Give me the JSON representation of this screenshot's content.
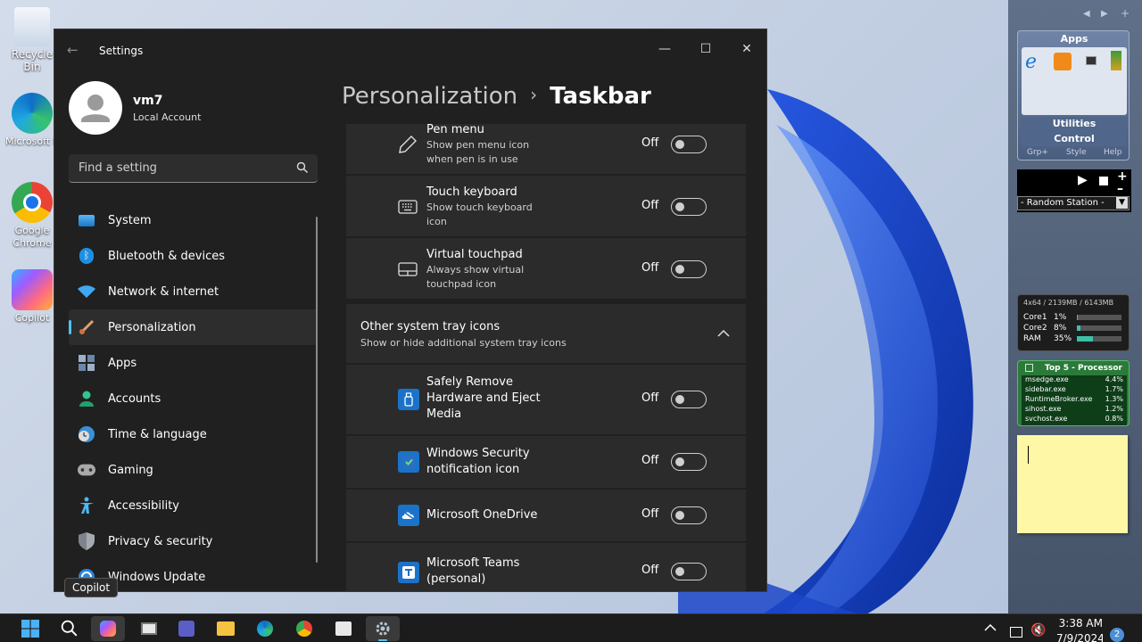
{
  "desktop": {
    "icons": [
      {
        "label": "Recycle Bin"
      },
      {
        "label": "Microsoft Edge"
      },
      {
        "label": "Google Chrome"
      },
      {
        "label": "Copilot"
      }
    ]
  },
  "window": {
    "title": "Settings",
    "back_glyph": "←",
    "minimize_glyph": "—",
    "maximize_glyph": "☐",
    "close_glyph": "✕"
  },
  "profile": {
    "name": "vm7",
    "account_type": "Local Account"
  },
  "search": {
    "placeholder": "Find a setting"
  },
  "nav": {
    "items": [
      {
        "label": "System",
        "icon": "system-icon"
      },
      {
        "label": "Bluetooth & devices",
        "icon": "bluetooth-icon"
      },
      {
        "label": "Network & internet",
        "icon": "wifi-icon"
      },
      {
        "label": "Personalization",
        "icon": "brush-icon",
        "active": true
      },
      {
        "label": "Apps",
        "icon": "apps-icon"
      },
      {
        "label": "Accounts",
        "icon": "accounts-icon"
      },
      {
        "label": "Time & language",
        "icon": "globe-clock-icon"
      },
      {
        "label": "Gaming",
        "icon": "gamepad-icon"
      },
      {
        "label": "Accessibility",
        "icon": "accessibility-icon"
      },
      {
        "label": "Privacy & security",
        "icon": "shield-icon"
      },
      {
        "label": "Windows Update",
        "icon": "update-icon"
      }
    ]
  },
  "breadcrumb": {
    "parent": "Personalization",
    "separator": "›",
    "current": "Taskbar"
  },
  "pen_rows": [
    {
      "title": "Pen menu",
      "subtitle_line1": "Show pen menu icon",
      "subtitle_line2": "when pen is in use",
      "state": "Off"
    },
    {
      "title": "Touch keyboard",
      "subtitle_line1": "Show touch keyboard",
      "subtitle_line2": "icon",
      "state": "Off"
    },
    {
      "title": "Virtual touchpad",
      "subtitle_line1": "Always show virtual",
      "subtitle_line2": "touchpad icon",
      "state": "Off"
    }
  ],
  "other_tray": {
    "title": "Other system tray icons",
    "subtitle": "Show or hide additional system tray icons",
    "chevron": "⌃",
    "items": [
      {
        "line1": "Safely Remove",
        "line2": "Hardware and Eject",
        "line3": "Media",
        "state": "Off"
      },
      {
        "line1": "Windows Security",
        "line2": "notification icon",
        "state": "Off"
      },
      {
        "line1": "Microsoft OneDrive",
        "state": "Off"
      },
      {
        "line1": "Microsoft Teams",
        "line2": "(personal)",
        "state": "Off"
      }
    ]
  },
  "sidebar_gadgets": {
    "apps_title": "Apps",
    "utilities": "Utilities",
    "control": "Control",
    "grp": "Grp+",
    "style": "Style",
    "help": "Help",
    "radio_station": "- Random Station -",
    "cpu_header": "4x64 / 2139MB / 6143MB",
    "cpu_rows": [
      {
        "label": "Core1",
        "value": "1%",
        "fill": 0.01
      },
      {
        "label": "Core2",
        "value": "8%",
        "fill": 0.08
      },
      {
        "label": "RAM",
        "value": "35%",
        "fill": 0.35
      }
    ],
    "top5_title": "Top 5 - Processor",
    "top5": [
      {
        "name": "msedge.exe",
        "value": "4.4%"
      },
      {
        "name": "sidebar.exe",
        "value": "1.7%"
      },
      {
        "name": "RuntimeBroker.exe",
        "value": "1.3%"
      },
      {
        "name": "sihost.exe",
        "value": "1.2%"
      },
      {
        "name": "svchost.exe",
        "value": "0.8%"
      }
    ]
  },
  "tooltip": "Copilot",
  "taskbar": {
    "time": "3:38 AM",
    "date": "7/9/2024",
    "notification_count": "2"
  }
}
